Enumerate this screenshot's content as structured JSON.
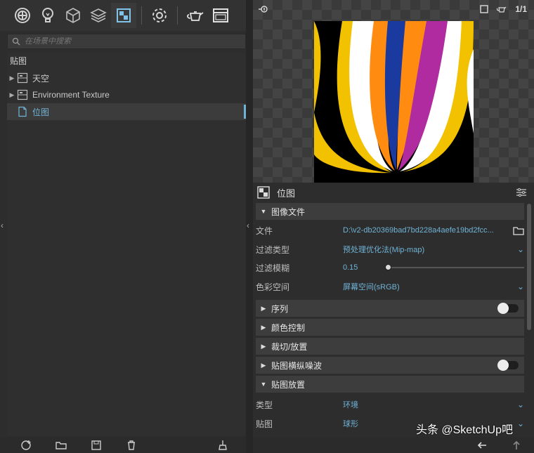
{
  "left_panel": {
    "toolbar": {
      "items": [
        "scene-icon",
        "light-icon",
        "geometry-icon",
        "layers-icon",
        "texture-icon",
        "settings-icon",
        "teapot-icon",
        "window-icon"
      ]
    },
    "search": {
      "placeholder": "在场景中搜索"
    },
    "tree": {
      "header": "贴图",
      "items": [
        {
          "label": "天空"
        },
        {
          "label": "Environment Texture"
        },
        {
          "label": "位图"
        }
      ]
    }
  },
  "right_panel": {
    "preview": {
      "counter": "1/1"
    },
    "title": "位图",
    "groups": {
      "image_file": "图像文件",
      "sequence": "序列",
      "color_control": "颜色控制",
      "crop_place": "裁切/放置",
      "noise": "贴图横纵噪波",
      "placement": "贴图放置"
    },
    "props": {
      "file": {
        "name": "文件",
        "value": "D:\\v2-db20369bad7bd228a4aefe19bd2fcc..."
      },
      "filter_type": {
        "name": "过滤类型",
        "value": "预处理优化法(Mip-map)"
      },
      "filter_blur": {
        "name": "过滤模糊",
        "value": "0.15"
      },
      "color_space": {
        "name": "色彩空间",
        "value": "屏幕空间(sRGB)"
      },
      "type": {
        "name": "类型",
        "value": "环境"
      },
      "mapping": {
        "name": "贴图",
        "value": "球形"
      }
    },
    "watermark": "头条 @SketchUp吧"
  }
}
